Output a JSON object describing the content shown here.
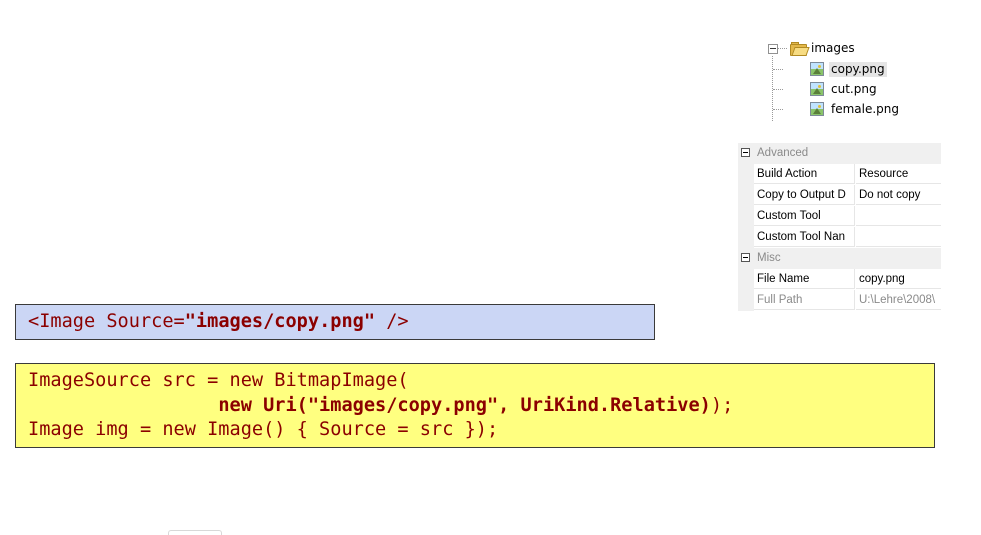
{
  "solution_explorer": {
    "folder": {
      "label": "images",
      "icon": "folder-icon"
    },
    "files": [
      {
        "label": "copy.png",
        "icon": "image-file-icon",
        "selected": true
      },
      {
        "label": "cut.png",
        "icon": "image-file-icon",
        "selected": false
      },
      {
        "label": "female.png",
        "icon": "image-file-icon",
        "selected": false
      }
    ]
  },
  "properties": {
    "categories": [
      {
        "label": "Advanced",
        "rows": [
          {
            "name": "Build Action",
            "value": "Resource"
          },
          {
            "name": "Copy to Output D",
            "value": "Do not copy"
          },
          {
            "name": "Custom Tool",
            "value": ""
          },
          {
            "name": "Custom Tool Nan",
            "value": ""
          }
        ]
      },
      {
        "label": "Misc",
        "rows": [
          {
            "name": "File Name",
            "value": "copy.png"
          },
          {
            "name": "Full Path",
            "value": "U:\\Lehre\\2008\\"
          }
        ]
      }
    ]
  },
  "xaml_code": {
    "prefix": "<Image Source=",
    "bold": "\"images/copy.png\"",
    "suffix": " />"
  },
  "csharp_code": {
    "line1": "ImageSource src = new BitmapImage(",
    "line2_indent": "                 ",
    "line2_bold": "new Uri(\"images/copy.png\", UriKind.Relative)",
    "line2_tail": ");",
    "line3": "Image img = new Image() { Source = src });"
  },
  "colors": {
    "xaml_box_bg": "#cbd6f5",
    "code_box_bg": "#ffff80",
    "code_text": "#8b0000"
  }
}
